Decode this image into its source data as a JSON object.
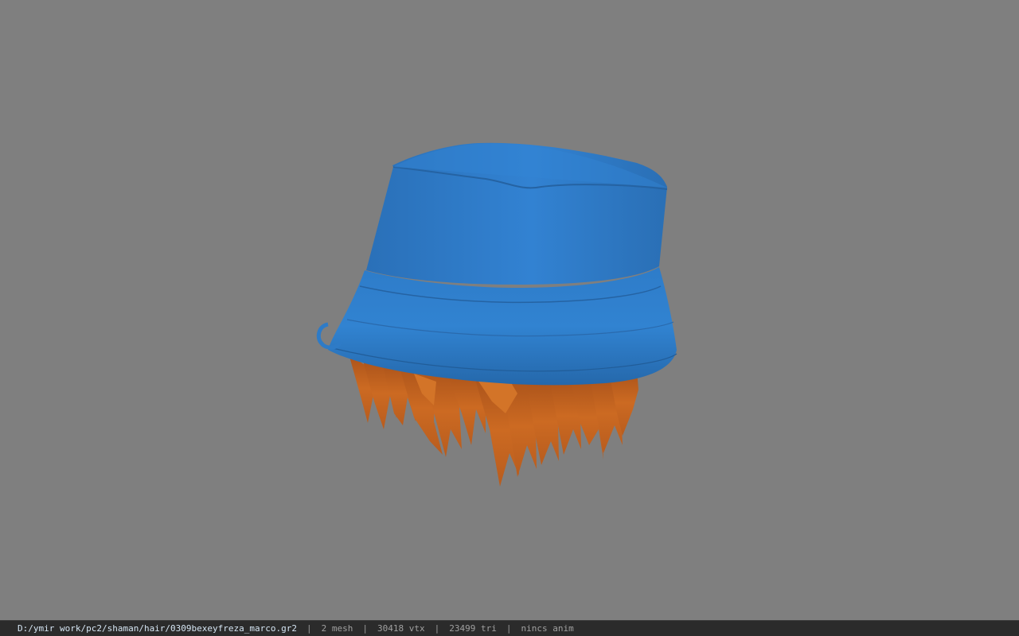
{
  "viewer": {
    "background_color": "#7f7f7f",
    "model": {
      "description_icon": "hat-hair-model",
      "hat_color": "#2f7fce",
      "hair_color": "#c8661e"
    }
  },
  "status_bar": {
    "file_path": "D:/ymir work/pc2/shaman/hair/0309bexeyfreza_marco.gr2",
    "separator": "|",
    "mesh_count": "2 mesh",
    "vertex_count": "30418 vtx",
    "triangle_count": "23499 tri",
    "anim_status": "nincs anim"
  }
}
